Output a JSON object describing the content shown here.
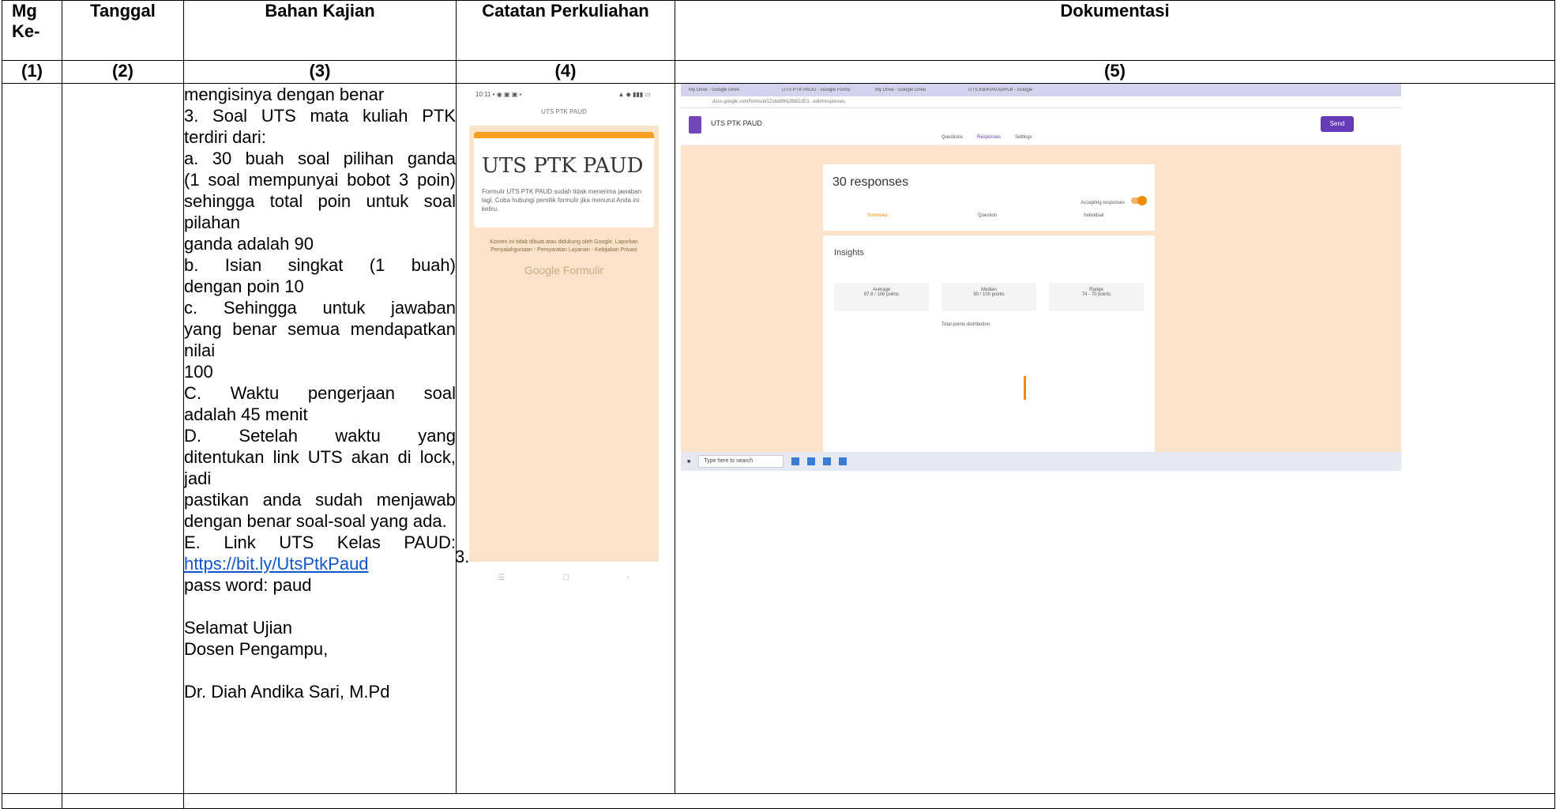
{
  "table": {
    "headers": {
      "mg": "Mg Ke-",
      "tanggal": "Tanggal",
      "bahan": "Bahan Kajian",
      "catatan": "Catatan Perkuliahan",
      "dokumentasi": "Dokumentasi"
    },
    "numbers": {
      "c1": "(1)",
      "c2": "(2)",
      "c3": "(3)",
      "c4": "(4)",
      "c5": "(5)"
    },
    "bahan_kajian": {
      "l1": "mengisinya dengan benar",
      "l2": "3.        Soal UTS mata kuliah PTK",
      "l3": "terdiri dari:",
      "l4": "a.         30 buah soal pilihan ganda",
      "l5": "(1 soal mempunyai bobot 3 poin)",
      "l6": "sehingga total poin untuk soal pilahan",
      "l7": "ganda adalah 90",
      "l8": "b.         Isian   singkat   (1   buah)",
      "l9": "dengan poin 10",
      "l10": "c.         Sehingga  untuk  jawaban",
      "l11": "yang benar semua mendapatkan nilai",
      "l12": "100",
      "l13": "C.        Waktu    pengerjaan    soal",
      "l14": "adalah 45 menit",
      "l15": "D.        Setelah       waktu       yang",
      "l16": "ditentukan link UTS akan di lock, jadi",
      "l17": "pastikan  anda  sudah  menjawab",
      "l18": "dengan benar soal-soal yang ada.",
      "l19": "E.        Link  UTS  Kelas  PAUD:",
      "link": "https://bit.ly/UtsPtkPaud",
      "l20": "pass word: paud",
      "l21": "Selamat Ujian",
      "l22": "Dosen Pengampu,",
      "l23": "Dr. Diah Andika Sari, M.Pd"
    },
    "catatan_stray": "3."
  },
  "phone_shot": {
    "status_left": "10:11 ▪ ◉ ▣ ▣ ▪",
    "status_right": "▲ ◆ ▮▮▮ ▭",
    "url": "UTS PTK PAUD",
    "title": "UTS PTK PAUD",
    "message": "Formulir UTS PTK PAUD sudah tidak menerima jawaban lagi. Coba hubungi pemilik formulir jika menurut Anda ini keliru.",
    "footer": "Konten ini tidak dibuat atau didukung oleh Google. Laporkan Penyalahgunaan - Persyaratan Layanan - Kebijakan Privasi",
    "brand": "Google Formulir"
  },
  "desktop_shot": {
    "tabs": [
      "My Drive - Google Drive",
      "UTS PTK PAUD - Google Forms",
      "My Drive - Google Drive",
      "UTS KB/KPAUD/PLB - Google"
    ],
    "address": "docs.google.com/forms/d/1ZsbdtBNj2B8D2E3...edit#responses",
    "form_title": "UTS PTK PAUD",
    "send": "Send",
    "tab_questions": "Questions",
    "tab_responses": "Responses",
    "tab_settings": "Settings",
    "responses_count": "30 responses",
    "accepting": "Accepting responses",
    "summary": "Summary",
    "question": "Question",
    "individual": "Individual",
    "insights": "Insights",
    "average": "Average",
    "average_val": "87.8 / 100 points",
    "median": "Median",
    "median_val": "90 / 100 points",
    "range": "Range",
    "range_val": "74 - 70 points",
    "distribution": "Total points distribution",
    "search": "Type here to search"
  }
}
